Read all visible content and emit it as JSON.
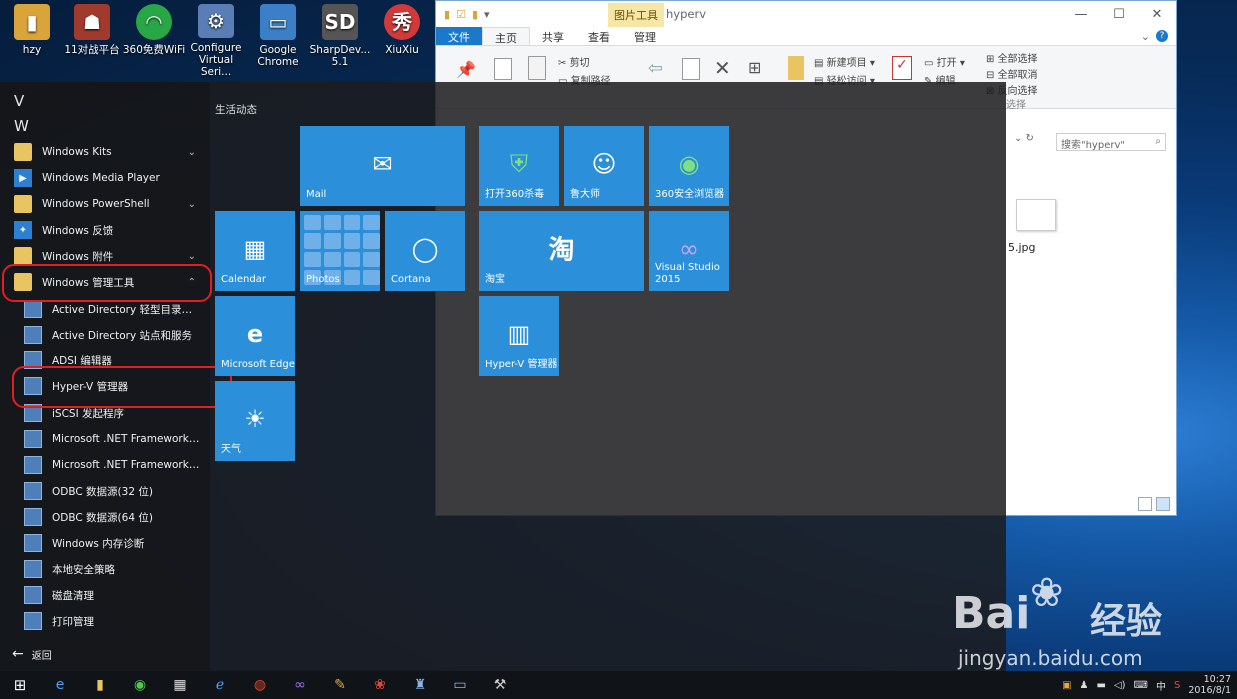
{
  "desktop": {
    "icons": [
      {
        "label": "hzy",
        "icon": "user-folder-icon",
        "color": "#d9a53a"
      },
      {
        "label": "11对战平台",
        "icon": "game-platform-icon",
        "color": "#a03a2c"
      },
      {
        "label": "360免费WiFi",
        "icon": "wifi-icon",
        "color": "#27a745"
      },
      {
        "label": "Configure Virtual Seri...",
        "icon": "configure-icon",
        "color": "#5a7db5"
      },
      {
        "label": "Google Chrome",
        "icon": "computer-shortcut-icon",
        "color": "#3b7fc8"
      },
      {
        "label": "SharpDev... 5.1",
        "icon": "sharpdevelop-icon",
        "color": "#555"
      },
      {
        "label": "XiuXiu",
        "icon": "xiuxiu-icon",
        "color": "#d23a3a"
      }
    ]
  },
  "explorer": {
    "title": "hyperv",
    "context_tab": "图片工具",
    "tabs": [
      "文件",
      "主页",
      "共享",
      "查看",
      "管理"
    ],
    "ribbon": {
      "cut": "剪切",
      "copy_path": "复制路径",
      "new_item": "新建项目 ▾",
      "easy_access": "轻松访问 ▾",
      "open": "打开 ▾",
      "edit": "编辑",
      "select_all": "全部选择",
      "select_none": "全部取消",
      "invert": "反向选择",
      "select_group": "选择"
    },
    "search_placeholder": "搜索\"hyperv\"",
    "file_name": "5.jpg"
  },
  "start": {
    "letters": [
      "V",
      "W"
    ],
    "apps": [
      {
        "label": "Windows Kits",
        "type": "folder",
        "chevron": "⌄"
      },
      {
        "label": "Windows Media Player",
        "type": "blue",
        "chevron": ""
      },
      {
        "label": "Windows PowerShell",
        "type": "folder",
        "chevron": "⌄"
      },
      {
        "label": "Windows 反馈",
        "type": "blue",
        "chevron": ""
      },
      {
        "label": "Windows 附件",
        "type": "folder",
        "chevron": "⌄"
      },
      {
        "label": "Windows 管理工具",
        "type": "folder",
        "chevron": "⌃"
      }
    ],
    "sub_apps": [
      "Active Directory 轻型目录服务...",
      "Active Directory 站点和服务",
      "ADSI 编辑器",
      "Hyper-V 管理器",
      "iSCSI 发起程序",
      "Microsoft .NET Framework 1....",
      "Microsoft .NET Framework 1....",
      "ODBC 数据源(32 位)",
      "ODBC 数据源(64 位)",
      "Windows 内存诊断",
      "本地安全策略",
      "磁盘清理",
      "打印管理"
    ],
    "back_label": "返回",
    "group_label": "生活动态",
    "tiles": {
      "mail": "Mail",
      "calendar": "Calendar",
      "photos": "Photos",
      "cortana": "Cortana",
      "edge": "Microsoft Edge",
      "weather": "天气",
      "antivirus": "打开360杀毒",
      "ludashi": "鲁大师",
      "browser360": "360安全浏览器",
      "taobao": "淘宝",
      "taobao_glyph": "淘",
      "vs": "Visual Studio 2015",
      "hyperv": "Hyper-V 管理器"
    }
  },
  "taskbar": {
    "clock_time": "10:27",
    "clock_date": "2016/8/1",
    "ime": "中"
  },
  "watermark": {
    "brand": "Bai",
    "brand2": "经验",
    "url": "jingyan.baidu.com"
  },
  "colors": {
    "tile_blue": "#2b8fd9",
    "highlight_ring": "#e02020",
    "ribbon_file_tab": "#1979ca"
  }
}
